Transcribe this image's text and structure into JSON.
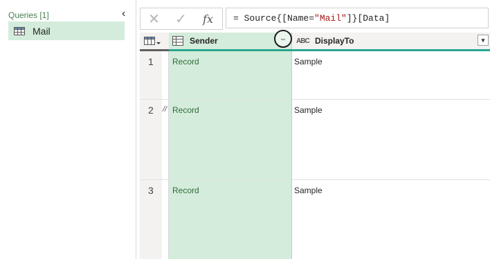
{
  "queries": {
    "header": "Queries [1]",
    "items": [
      {
        "label": "Mail",
        "icon": "table-icon"
      }
    ]
  },
  "formula_bar": {
    "cancel_icon": "✕",
    "commit_icon": "✓",
    "fx_label": "fx",
    "formula_prefix": "= Source{[Name=",
    "formula_string": "\"Mail\"",
    "formula_suffix": "]}[Data]"
  },
  "grid": {
    "columns": [
      {
        "label": "Sender",
        "type_icon": "table-icon"
      },
      {
        "label": "DisplayTo",
        "type_icon": "abc-icon",
        "type_text": "ABC"
      }
    ],
    "rows": [
      {
        "num": "1",
        "sender": "Record",
        "display_to": "Sample"
      },
      {
        "num": "2",
        "sender": "Record",
        "display_to": "Sample"
      },
      {
        "num": "3",
        "sender": "Record",
        "display_to": "Sample"
      }
    ]
  },
  "colors": {
    "selected_column": "#d4ecdb",
    "accent_green": "#2aa691",
    "record_text": "#2e6b3a"
  }
}
